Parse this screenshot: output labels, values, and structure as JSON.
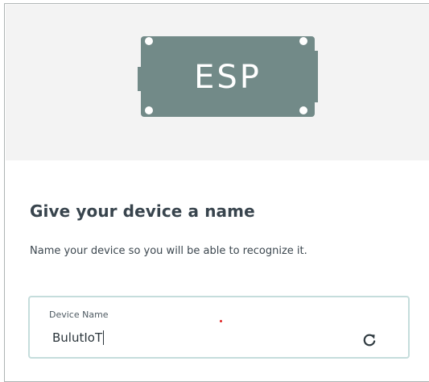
{
  "hero": {
    "chip_label": "ESP",
    "chip_color": "#728a88",
    "background": "#f3f3f3"
  },
  "content": {
    "title": "Give your device a name",
    "subtitle": "Name your device so you will be able to recognize it."
  },
  "field": {
    "label": "Device Name",
    "value": "BulutIoT",
    "action_icon": "refresh-icon",
    "border_color": "#c5dddc"
  },
  "marker": {
    "color": "#e02424"
  }
}
